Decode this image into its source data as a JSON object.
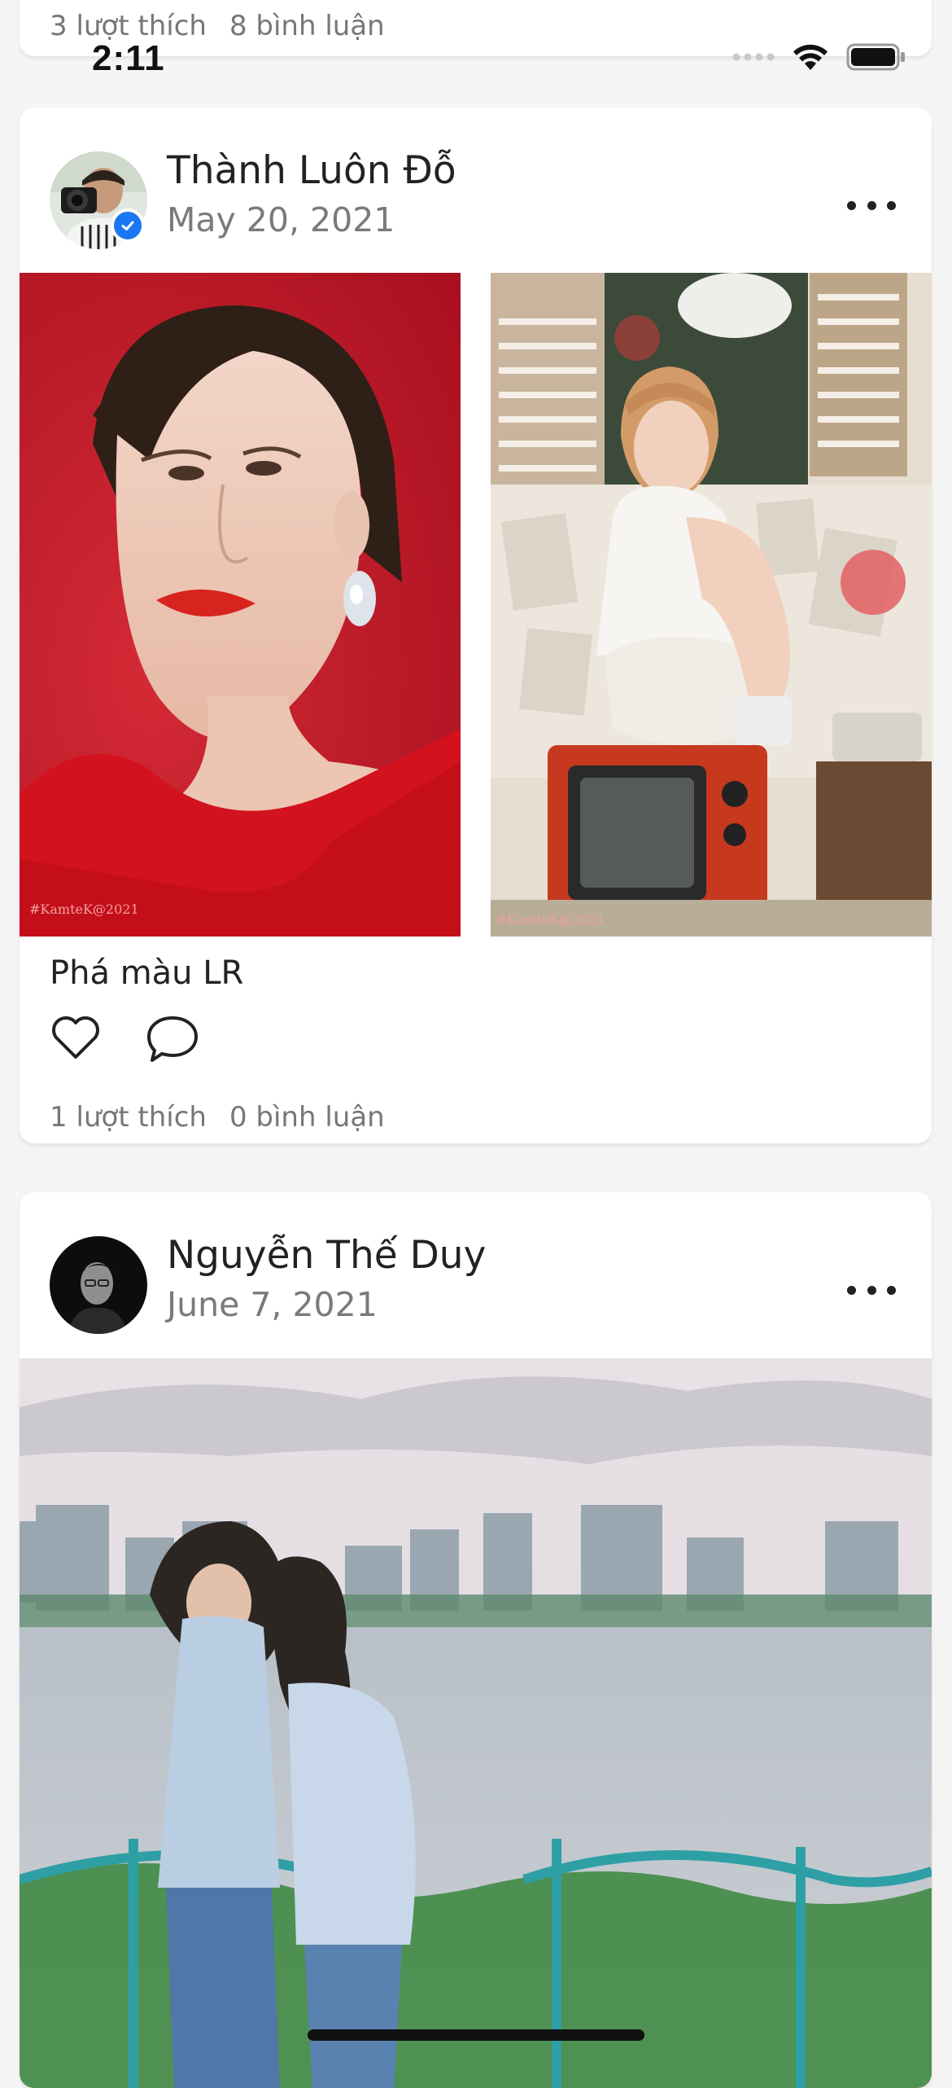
{
  "status_bar": {
    "time": "2:11",
    "icons": [
      "signal-icon",
      "wifi-icon",
      "battery-icon"
    ]
  },
  "prev_post": {
    "likes": "3 lượt thích",
    "comments": "8 bình luận"
  },
  "posts": [
    {
      "user_name": "Thành Luôn Đỗ",
      "date": "May 20, 2021",
      "verified": true,
      "caption": "Phá màu LR",
      "likes": "1 lượt thích",
      "comments": "0 bình luận",
      "photos": [
        {
          "watermark": "#KamteK@2021"
        },
        {
          "watermark": "#KamteK@2021"
        }
      ]
    },
    {
      "user_name": "Nguyễn Thế Duy",
      "date": "June 7, 2021",
      "verified": false
    }
  ],
  "colors": {
    "background": "#f5f5f5",
    "card": "#ffffff",
    "verified_blue": "#1877f2",
    "secondary_text": "#7a7a7a"
  }
}
